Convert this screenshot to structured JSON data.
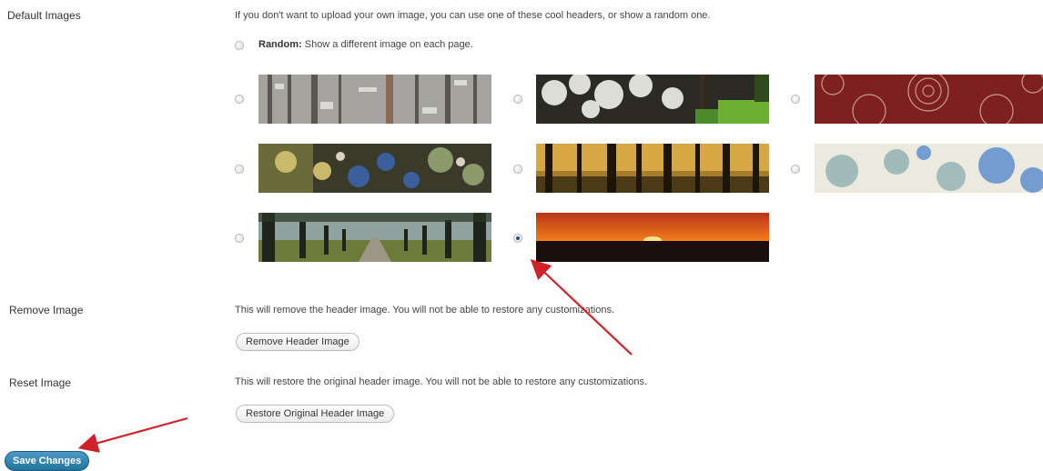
{
  "default_images": {
    "label": "Default Images",
    "description": "If you don't want to upload your own image, you can use one of these cool headers, or show a random one.",
    "random_bold": "Random:",
    "random_text": "Show a different image on each page.",
    "images": [
      {
        "name": "snowy-forest",
        "selected": false
      },
      {
        "name": "white-blossoms",
        "selected": false
      },
      {
        "name": "red-lace",
        "selected": false
      },
      {
        "name": "flowers",
        "selected": false
      },
      {
        "name": "forest-sunset",
        "selected": false
      },
      {
        "name": "blue-pattern",
        "selected": false
      },
      {
        "name": "tree-lined-path",
        "selected": false
      },
      {
        "name": "sunset-horizon",
        "selected": true
      }
    ]
  },
  "remove_image": {
    "label": "Remove Image",
    "description": "This will remove the header image. You will not be able to restore any customizations.",
    "button": "Remove Header Image"
  },
  "reset_image": {
    "label": "Reset Image",
    "description": "This will restore the original header image. You will not be able to restore any customizations.",
    "button": "Restore Original Header Image"
  },
  "save_button": "Save Changes",
  "colors": {
    "accent": "#21759b",
    "arrow": "#d0202a"
  }
}
